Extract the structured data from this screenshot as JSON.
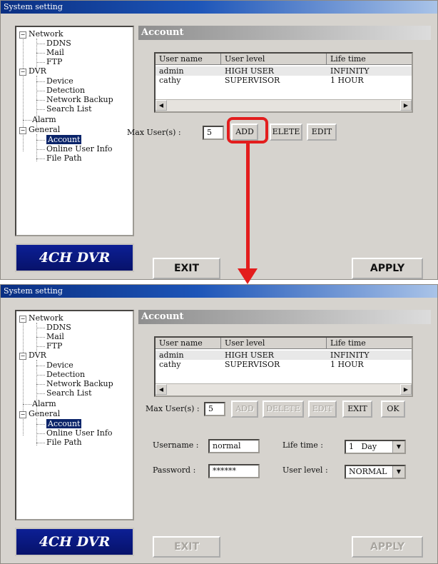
{
  "top": {
    "window_title": "System setting",
    "tree": {
      "network": "Network",
      "ddns": "DDNS",
      "mail": "Mail",
      "ftp": "FTP",
      "dvr": "DVR",
      "device": "Device",
      "detection": "Detection",
      "network_backup": "Network Backup",
      "search_list": "Search List",
      "alarm": "Alarm",
      "general": "General",
      "account": "Account",
      "online_user_info": "Online User Info",
      "file_path": "File Path"
    },
    "brand": "4CH DVR",
    "section_title": "Account",
    "table": {
      "headers": [
        "User name",
        "User level",
        "Life time"
      ],
      "rows": [
        [
          "admin",
          "HIGH USER",
          "INFINITY"
        ],
        [
          "cathy",
          "SUPERVISOR",
          "1 HOUR"
        ]
      ]
    },
    "max_users_label": "Max User(s) :",
    "max_users_value": "5",
    "add_label": "ADD",
    "delete_label": "ELETE",
    "edit_label": "EDIT",
    "exit_label": "EXIT",
    "apply_label": "APPLY"
  },
  "bottom": {
    "window_title": "System setting",
    "tree": {
      "network": "Network",
      "ddns": "DDNS",
      "mail": "Mail",
      "ftp": "FTP",
      "dvr": "DVR",
      "device": "Device",
      "detection": "Detection",
      "network_backup": "Network Backup",
      "search_list": "Search List",
      "alarm": "Alarm",
      "general": "General",
      "account": "Account",
      "online_user_info": "Online User Info",
      "file_path": "File Path"
    },
    "brand": "4CH DVR",
    "section_title": "Account",
    "table": {
      "headers": [
        "User name",
        "User level",
        "Life time"
      ],
      "rows": [
        [
          "admin",
          "HIGH USER",
          "INFINITY"
        ],
        [
          "cathy",
          "SUPERVISOR",
          "1 HOUR"
        ]
      ]
    },
    "max_users_label": "Max User(s) :",
    "max_users_value": "5",
    "add_label": "ADD",
    "delete_label": "DELETE",
    "edit_label": "EDIT",
    "exit_form_label": "EXIT",
    "ok_label": "OK",
    "username_label": "Username :",
    "username_value": "normal",
    "password_label": "Password :",
    "password_value": "******",
    "lifetime_label": "Life time :",
    "lifetime_value": "1   Day",
    "userlevel_label": "User level :",
    "userlevel_value": "NORMAL",
    "exit_label": "EXIT",
    "apply_label": "APPLY"
  },
  "annotation_color": "#e31d1d"
}
